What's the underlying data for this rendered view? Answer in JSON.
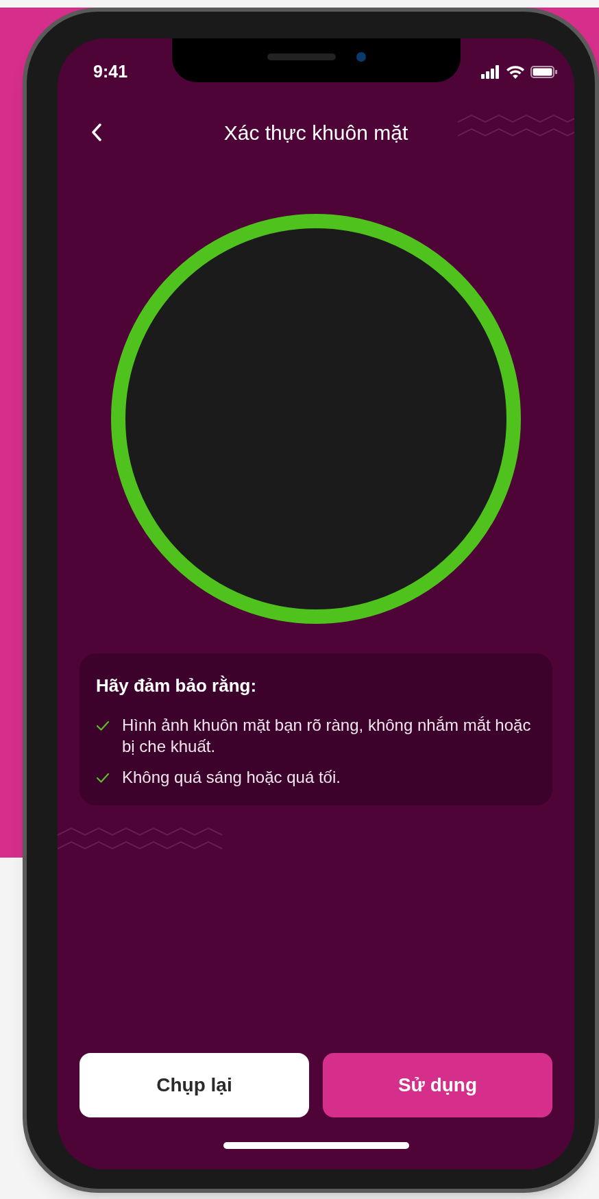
{
  "status_bar": {
    "time": "9:41"
  },
  "header": {
    "title": "Xác thực khuôn mặt"
  },
  "checklist": {
    "title": "Hãy đảm bảo rằng:",
    "items": [
      "Hình ảnh khuôn mặt bạn rõ ràng, không nhắm mắt hoặc bị che khuất.",
      "Không quá sáng hoặc quá tối."
    ]
  },
  "buttons": [
    {
      "label": "Chụp lại",
      "kind": "secondary"
    },
    {
      "label": "Sử dụng",
      "kind": "primary"
    }
  ]
}
